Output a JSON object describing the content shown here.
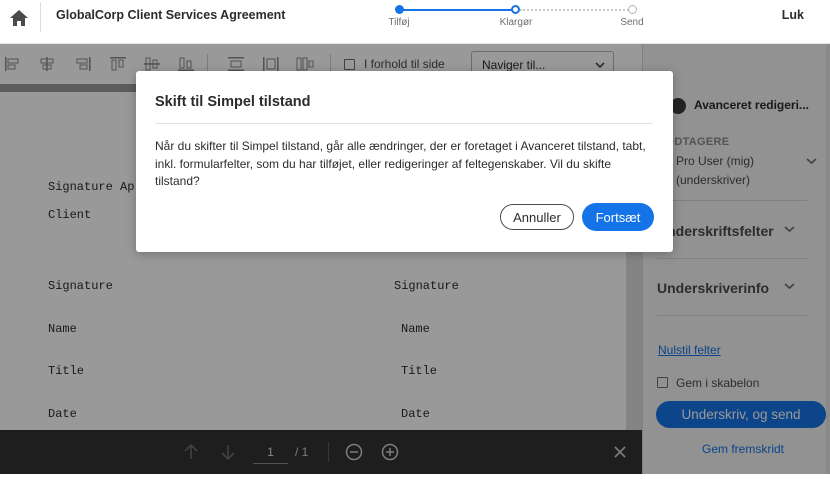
{
  "header": {
    "doc_title": "GlobalCorp Client Services Agreement",
    "steps": [
      {
        "label": "Tilføj",
        "state": "done"
      },
      {
        "label": "Klargør",
        "state": "current"
      },
      {
        "label": "Send",
        "state": "pending"
      }
    ],
    "close_label": "Luk"
  },
  "toolbar": {
    "icons": [
      "align-left-icon",
      "align-center-icon",
      "align-right-icon",
      "align-top-icon",
      "align-middle-icon",
      "align-bottom-icon",
      "distribute-horizontal-icon",
      "distribute-vertical-icon",
      "size-match-icon"
    ],
    "proportion_label": "I forhold til side",
    "navigate_label": "Naviger til..."
  },
  "document": {
    "lines": [
      {
        "text": "Signature Ap",
        "col": "left"
      },
      {
        "text": "Client",
        "col": "left"
      },
      {
        "text": "Signature",
        "col": "left"
      },
      {
        "text": "Signature",
        "col": "right"
      },
      {
        "text": "Name",
        "col": "left"
      },
      {
        "text": "Name",
        "col": "right"
      },
      {
        "text": "Title",
        "col": "left"
      },
      {
        "text": "Title",
        "col": "right"
      },
      {
        "text": "Date",
        "col": "left"
      },
      {
        "text": "Date",
        "col": "right"
      }
    ]
  },
  "pager": {
    "current_page": "1",
    "total": "/ 1"
  },
  "panel": {
    "toggle_label": "Avanceret redigeri...",
    "recipients_heading": "MODTAGERE",
    "recipient_name": "Pro User (mig)",
    "recipient_role": "(underskriver)",
    "section1": "Underskriftsfelter",
    "section2": "Underskriverinfo",
    "reset_link": "Nulstil felter",
    "save_template_label": "Gem i skabelon",
    "sign_send_label": "Underskriv, og send",
    "save_progress_label": "Gem fremskridt"
  },
  "modal": {
    "title": "Skift til Simpel tilstand",
    "body": "Når du skifter til Simpel tilstand, går alle ændringer, der er foretaget i Avanceret tilstand, tabt, inkl. formularfelter, som du har tilføjet, eller redigeringer af feltegenskaber. Vil du skifte tilstand?",
    "cancel_label": "Annuller",
    "continue_label": "Fortsæt"
  },
  "colors": {
    "accent": "#1473e6",
    "overlay": "rgba(0,0,0,0.40)",
    "pager_bg": "#323232"
  }
}
